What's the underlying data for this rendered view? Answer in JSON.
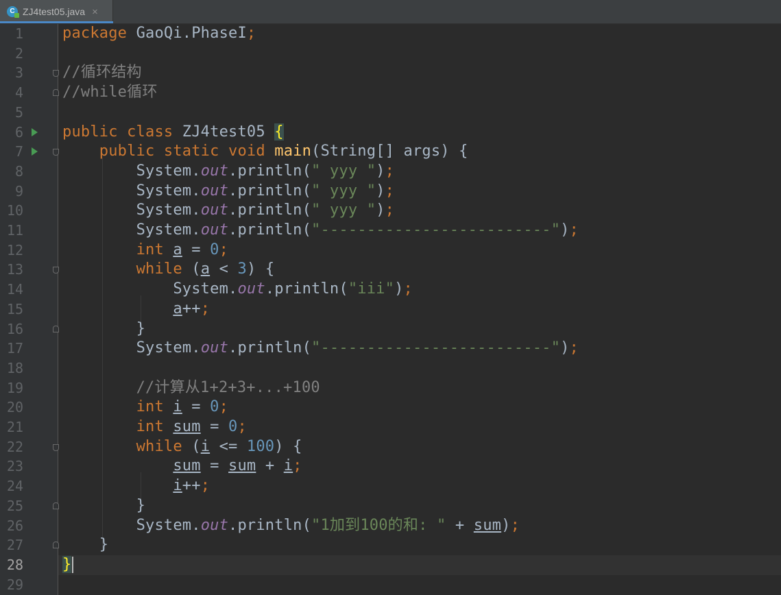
{
  "tab": {
    "filename": "ZJ4test05.java",
    "close": "×",
    "icon_letter": "C"
  },
  "lines": [
    {
      "n": "1"
    },
    {
      "n": "2"
    },
    {
      "n": "3"
    },
    {
      "n": "4"
    },
    {
      "n": "5"
    },
    {
      "n": "6"
    },
    {
      "n": "7"
    },
    {
      "n": "8"
    },
    {
      "n": "9"
    },
    {
      "n": "10"
    },
    {
      "n": "11"
    },
    {
      "n": "12"
    },
    {
      "n": "13"
    },
    {
      "n": "14"
    },
    {
      "n": "15"
    },
    {
      "n": "16"
    },
    {
      "n": "17"
    },
    {
      "n": "18"
    },
    {
      "n": "19"
    },
    {
      "n": "20"
    },
    {
      "n": "21"
    },
    {
      "n": "22"
    },
    {
      "n": "23"
    },
    {
      "n": "24"
    },
    {
      "n": "25"
    },
    {
      "n": "26"
    },
    {
      "n": "27"
    },
    {
      "n": "28"
    },
    {
      "n": "29"
    }
  ],
  "code": {
    "l1": {
      "kw": "package",
      "pkg": " GaoQi.PhaseI",
      "semi": ";"
    },
    "l3": {
      "cmt": "//循环结构"
    },
    "l4": {
      "cmt": "//while循环"
    },
    "l6": {
      "kw": "public class",
      "name": " ZJ4test05 ",
      "brace": "{"
    },
    "l7": {
      "kw": "public static void",
      "fn": "main",
      "rest": "(String[] args) {"
    },
    "println_prefix": "System.",
    "out": "out",
    "println": ".println(",
    "l8": {
      "str": "\" yyy \""
    },
    "l9": {
      "str": "\" yyy \""
    },
    "l10": {
      "str": "\" yyy \""
    },
    "l11": {
      "str": "\"-------------------------\""
    },
    "l12": {
      "kw": "int",
      "var": "a",
      "rest": " = ",
      "num": "0"
    },
    "l13": {
      "kw": "while",
      "open": " (",
      "var": "a",
      "op": " < ",
      "num": "3",
      "close": ") {"
    },
    "l14": {
      "str": "\"iii\""
    },
    "l15": {
      "var": "a",
      "rest": "++"
    },
    "l16": {
      "brace": "}"
    },
    "l17": {
      "str": "\"-------------------------\""
    },
    "l19": {
      "cmt": "//计算从1+2+3+...+100"
    },
    "l20": {
      "kw": "int",
      "var": "i",
      "rest": " = ",
      "num": "0"
    },
    "l21": {
      "kw": "int",
      "var": "sum",
      "rest": " = ",
      "num": "0"
    },
    "l22": {
      "kw": "while",
      "open": " (",
      "var": "i",
      "op": " <= ",
      "num": "100",
      "close": ") {"
    },
    "l23": {
      "var1": "sum",
      "eq": " = ",
      "var2": "sum",
      "plus": " + ",
      "var3": "i"
    },
    "l24": {
      "var": "i",
      "rest": "++"
    },
    "l25": {
      "brace": "}"
    },
    "l26": {
      "str": "\"1加到100的和: \"",
      "plus": " + ",
      "var": "sum",
      "close": ")"
    },
    "l27": {
      "brace": "}"
    },
    "l28": {
      "brace": "}"
    },
    "close_paren": ")",
    "semi": ";"
  },
  "colors": {
    "background": "#2b2b2b",
    "keyword": "#cc7832",
    "string": "#6a8759",
    "number": "#6897bb",
    "comment": "#808080",
    "field": "#9876aa",
    "method": "#ffc66d"
  }
}
